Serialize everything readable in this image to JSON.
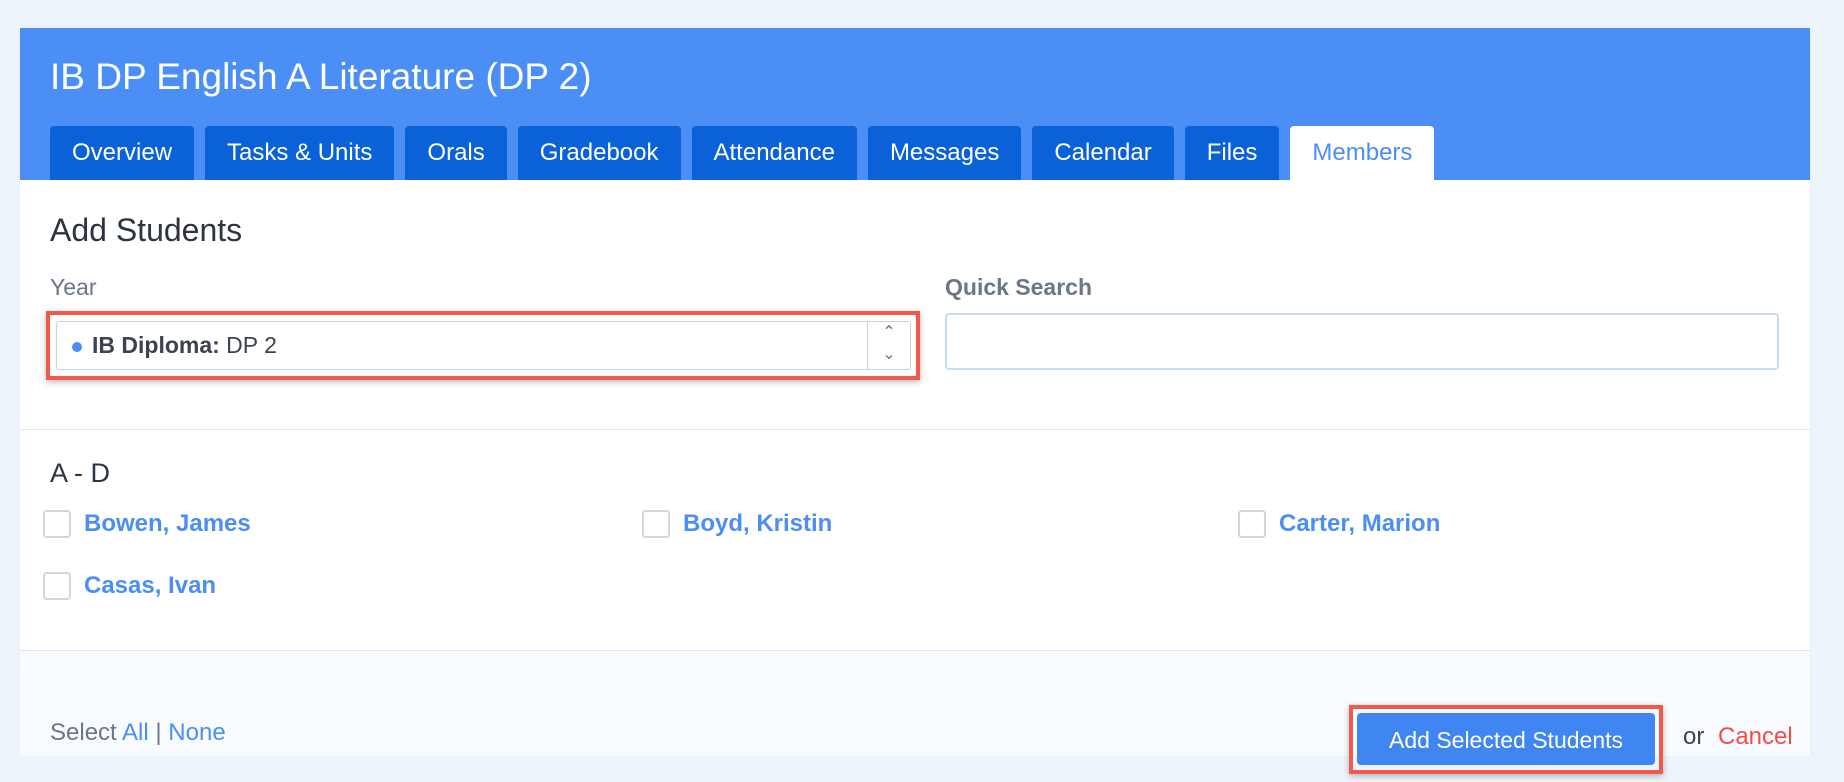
{
  "header": {
    "title": "IB DP English A Literature (DP 2)",
    "background_color": "#4b8ef5",
    "tab_color": "#0b61d8",
    "active_tab": "Members",
    "tabs": [
      {
        "label": "Overview"
      },
      {
        "label": "Tasks & Units"
      },
      {
        "label": "Orals"
      },
      {
        "label": "Gradebook"
      },
      {
        "label": "Attendance"
      },
      {
        "label": "Messages"
      },
      {
        "label": "Calendar"
      },
      {
        "label": "Files"
      },
      {
        "label": "Members"
      }
    ]
  },
  "form": {
    "section_title": "Add Students",
    "year": {
      "label": "Year",
      "selected_prefix": "IB Diploma:",
      "selected_value": "DP 2",
      "indicator_color": "#4b8ef5",
      "stepper_up_icon": "chevron-up-icon",
      "stepper_down_icon": "chevron-down-icon"
    },
    "quick_search": {
      "label": "Quick Search",
      "value": "",
      "placeholder": ""
    }
  },
  "student_list": {
    "group_title": "A - D",
    "students": [
      {
        "name": "Bowen, James",
        "checked": false
      },
      {
        "name": "Boyd, Kristin",
        "checked": false
      },
      {
        "name": "Carter, Marion",
        "checked": false
      },
      {
        "name": "Casas, Ivan",
        "checked": false
      }
    ]
  },
  "footer": {
    "select_label": "Select",
    "select_all": "All",
    "separator": "|",
    "select_none": "None",
    "add_selected_label": "Add Selected Students",
    "or_label": "or",
    "cancel_label": "Cancel",
    "cancel_color": "#f24d45"
  },
  "highlight_color": "#f15a4b"
}
